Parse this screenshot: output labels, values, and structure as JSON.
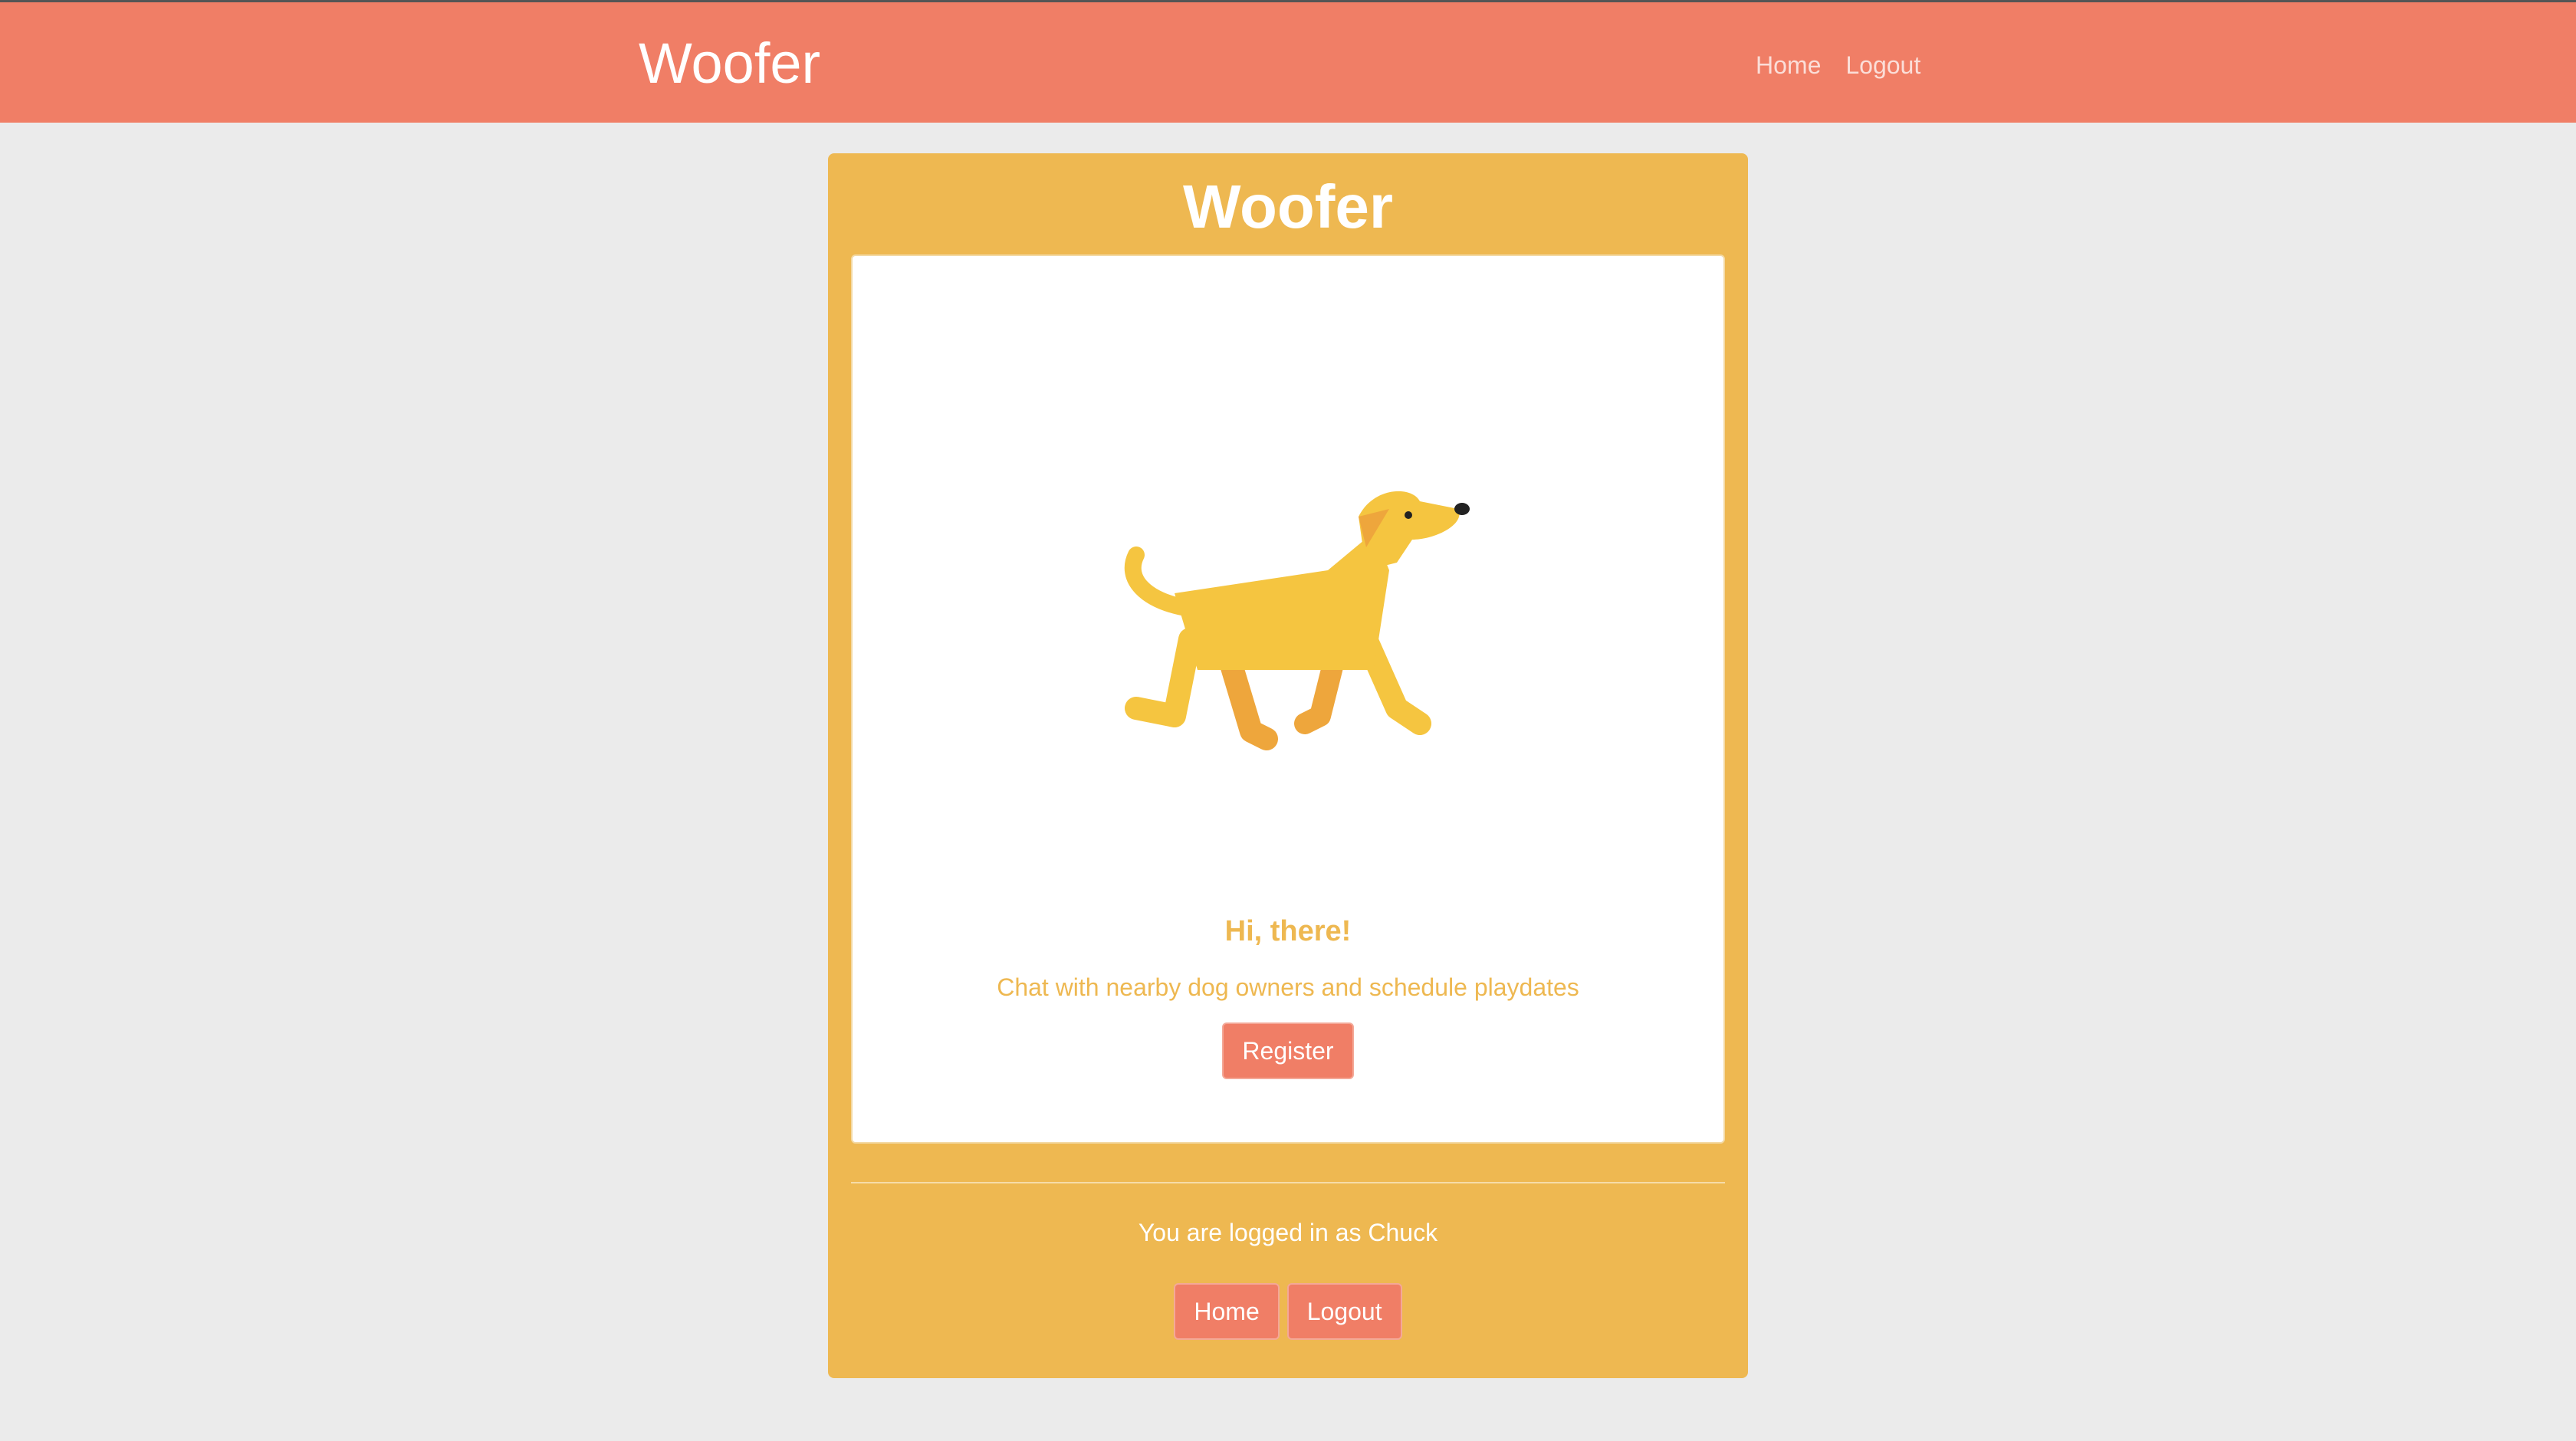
{
  "navbar": {
    "brand": "Woofer",
    "links": [
      "Home",
      "Logout"
    ]
  },
  "card": {
    "title": "Woofer",
    "illustration": "yellow-dog-illustration",
    "greeting": "Hi, there!",
    "tagline": "Chat with nearby dog owners and schedule playdates",
    "register_label": "Register",
    "logged_in_text": "You are logged in as Chuck",
    "home_label": "Home",
    "logout_label": "Logout"
  },
  "colors": {
    "navbar": "#f07e66",
    "card": "#eeb851",
    "background": "#ebebeb",
    "button": "#f07e66"
  }
}
